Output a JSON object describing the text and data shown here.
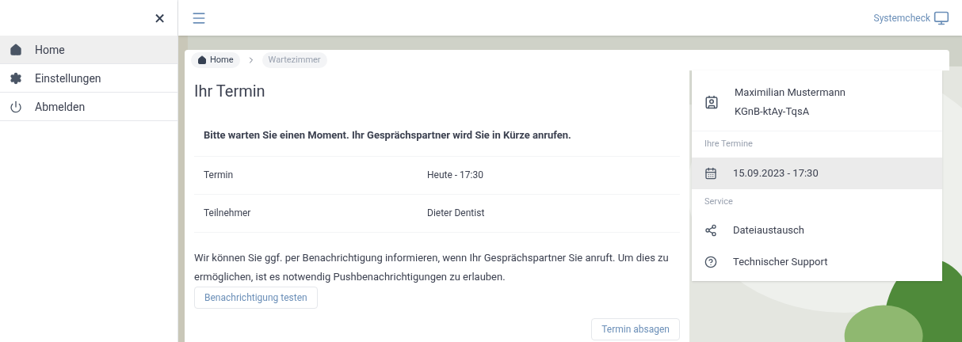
{
  "sidebar": {
    "close": "×",
    "items": [
      {
        "kind": "home",
        "label": "Home",
        "selected": true
      },
      {
        "kind": "settings",
        "label": "Einstellungen",
        "selected": false
      },
      {
        "kind": "logout",
        "label": "Abmelden",
        "selected": false
      }
    ]
  },
  "topbar": {
    "systemcheck": "Systemcheck"
  },
  "breadcrumb": [
    {
      "kind": "home",
      "label": "Home",
      "disabled": false
    },
    {
      "kind": "page",
      "label": "Wartezimmer",
      "disabled": true
    }
  ],
  "appointment": {
    "title": "Ihr Termin",
    "notice": "Bitte warten Sie einen Moment. Ihr Gesprächspartner wird Sie in Kürze anrufen.",
    "rows": [
      {
        "label": "Termin",
        "value": "Heute - 17:30"
      },
      {
        "label": "Teilnehmer",
        "value": "Dieter Dentist"
      }
    ],
    "info": "Wir können Sie ggf. per Benachrichtigung informieren, wenn Ihr Gesprächspartner Sie anruft. Um dies zu ermöglichen, ist es notwendig Pushbenachrichtigungen zu erlauben.",
    "test_button": "Benachrichtigung testen",
    "cancel_button": "Termin absagen"
  },
  "profile": {
    "name": "Maximilian Mustermann",
    "code": "KGnB-ktAy-TqsA"
  },
  "appointments_section": {
    "heading": "Ihre Termine",
    "items": [
      {
        "label": "15.09.2023 - 17:30",
        "selected": true
      }
    ]
  },
  "service_section": {
    "heading": "Service",
    "items": [
      {
        "kind": "share",
        "label": "Dateiaustausch"
      },
      {
        "kind": "help",
        "label": "Technischer Support"
      }
    ]
  }
}
